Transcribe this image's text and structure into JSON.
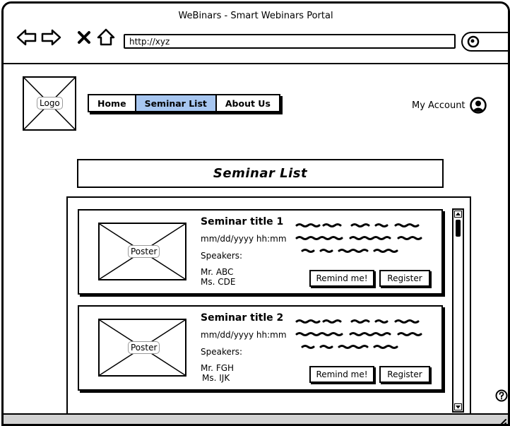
{
  "window": {
    "title": "WeBinars - Smart Webinars Portal",
    "url": "http://xyz"
  },
  "header": {
    "logo_label": "Logo",
    "tabs": [
      {
        "label": "Home",
        "active": false
      },
      {
        "label": "Seminar List",
        "active": true
      },
      {
        "label": "About Us",
        "active": false
      }
    ],
    "account_label": "My Account",
    "accent_color": "#a7c6f0"
  },
  "main": {
    "heading": "Seminar List",
    "seminars": [
      {
        "poster_label": "Poster",
        "title": "Seminar title 1",
        "datetime": "mm/dd/yyyy hh:mm",
        "speakers_label": "Speakers:",
        "speakers": [
          "Mr. ABC",
          "Ms. CDE"
        ],
        "remind_label": "Remind me!",
        "register_label": "Register"
      },
      {
        "poster_label": "Poster",
        "title": "Seminar title 2",
        "datetime": "mm/dd/yyyy hh:mm",
        "speakers_label": "Speakers:",
        "speakers": [
          "Mr. FGH",
          "Ms. IJK"
        ],
        "remind_label": "Remind me!",
        "register_label": "Register"
      }
    ]
  },
  "icons": {
    "back": "arrow-left-icon",
    "forward": "arrow-right-icon",
    "close": "close-icon",
    "home": "home-icon",
    "search": "search-icon",
    "account": "user-icon",
    "help": "help-icon",
    "resize": "resize-grip-icon"
  }
}
